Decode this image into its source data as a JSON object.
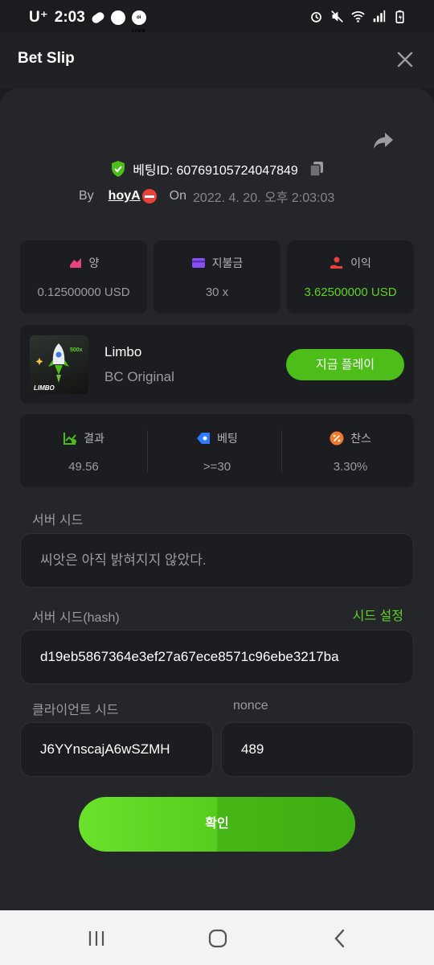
{
  "status": {
    "time": "2:03",
    "carrier": "U⁺",
    "lock_badge": "oi LOCK"
  },
  "header": {
    "title": "Bet Slip"
  },
  "bet": {
    "id_text": "베팅ID: 60769105724047849",
    "by_label": "By",
    "user": "hoyA",
    "on_label": "On",
    "date": "2022. 4. 20. 오후 2:03:03"
  },
  "stats_top": [
    {
      "label": "양",
      "value": "0.12500000 USD"
    },
    {
      "label": "지불금",
      "value": "30 x"
    },
    {
      "label": "이익",
      "value": "3.62500000 USD"
    }
  ],
  "game": {
    "name": "Limbo",
    "subtitle": "BC Original",
    "thumb_text": "LIMBO",
    "thumb_multiplier": "500x",
    "play_label": "지금 플레이"
  },
  "stats_bottom": [
    {
      "label": "결과",
      "value": "49.56"
    },
    {
      "label": "베팅",
      "value": ">=30"
    },
    {
      "label": "찬스",
      "value": "3.30%"
    }
  ],
  "form": {
    "server_seed_label": "서버 시드",
    "server_seed_value": "씨앗은 아직 밝혀지지 않았다.",
    "server_hash_label": "서버 시드(hash)",
    "seed_settings_label": "시드 설정",
    "server_hash_value": "d19eb5867364e3ef27a67ece8571c96ebe3217ba",
    "client_seed_label": "클라이언트 시드",
    "client_seed_value": "J6YYnscajA6wSZMH",
    "nonce_label": "nonce",
    "nonce_value": "489"
  },
  "confirm_label": "확인",
  "colors": {
    "accent_green": "#5fd226",
    "background": "#1b1c1f",
    "card": "#1c1d20"
  }
}
